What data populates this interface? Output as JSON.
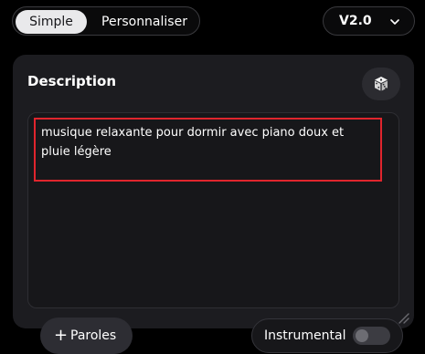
{
  "mode_toggle": {
    "simple_label": "Simple",
    "custom_label": "Personnaliser",
    "selected": "Simple"
  },
  "version_select": {
    "value": "V2.0",
    "icon": "chevron-down-icon"
  },
  "description_panel": {
    "title": "Description",
    "random_icon": "dice-icon",
    "prompt_text": "musique relaxante pour dormir avec piano doux et pluie légère",
    "prompt_highlight_color": "#e0252d",
    "lyrics_button_label": "Paroles",
    "lyrics_button_icon": "plus-icon",
    "instrumental_label": "Instrumental",
    "instrumental_on": false
  },
  "colors": {
    "background": "#000000",
    "panel": "#1c1c20",
    "selected_toggle": "#e9e9eb"
  }
}
